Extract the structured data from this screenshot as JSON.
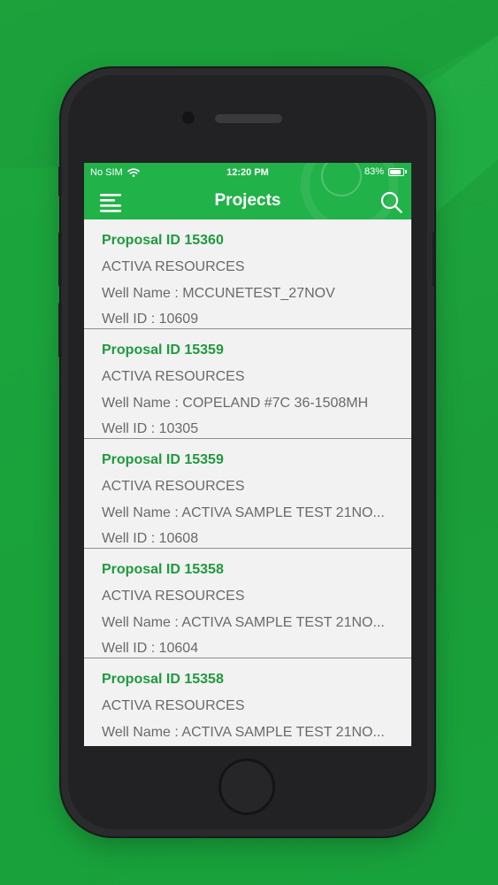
{
  "status_bar": {
    "carrier": "No SIM",
    "time": "12:20 PM",
    "battery": "83%",
    "battery_level": 0.83
  },
  "header": {
    "title": "Projects",
    "menu_icon": "hamburger-menu-icon",
    "search_icon": "search-icon"
  },
  "colors": {
    "accent": "#22b24a",
    "proposal_text": "#1f9a3e",
    "body_text": "#6a6a6a",
    "list_background": "#f2f2f2"
  },
  "projects": [
    {
      "proposal": "Proposal ID 15360",
      "company": "ACTIVA RESOURCES",
      "well_name": "Well Name :  MCCUNETEST_27NOV",
      "well_id": "Well ID :  10609"
    },
    {
      "proposal": "Proposal ID 15359",
      "company": "ACTIVA RESOURCES",
      "well_name": "Well Name :  COPELAND #7C 36-1508MH",
      "well_id": "Well ID :  10305"
    },
    {
      "proposal": "Proposal ID 15359",
      "company": "ACTIVA RESOURCES",
      "well_name": "Well Name :  ACTIVA SAMPLE TEST 21NO...",
      "well_id": "Well ID :  10608"
    },
    {
      "proposal": "Proposal ID 15358",
      "company": "ACTIVA RESOURCES",
      "well_name": "Well Name :  ACTIVA SAMPLE TEST 21NO...",
      "well_id": "Well ID :  10604"
    },
    {
      "proposal": "Proposal ID 15358",
      "company": "ACTIVA RESOURCES",
      "well_name": "Well Name :  ACTIVA SAMPLE TEST 21NO...",
      "well_id": ""
    }
  ]
}
